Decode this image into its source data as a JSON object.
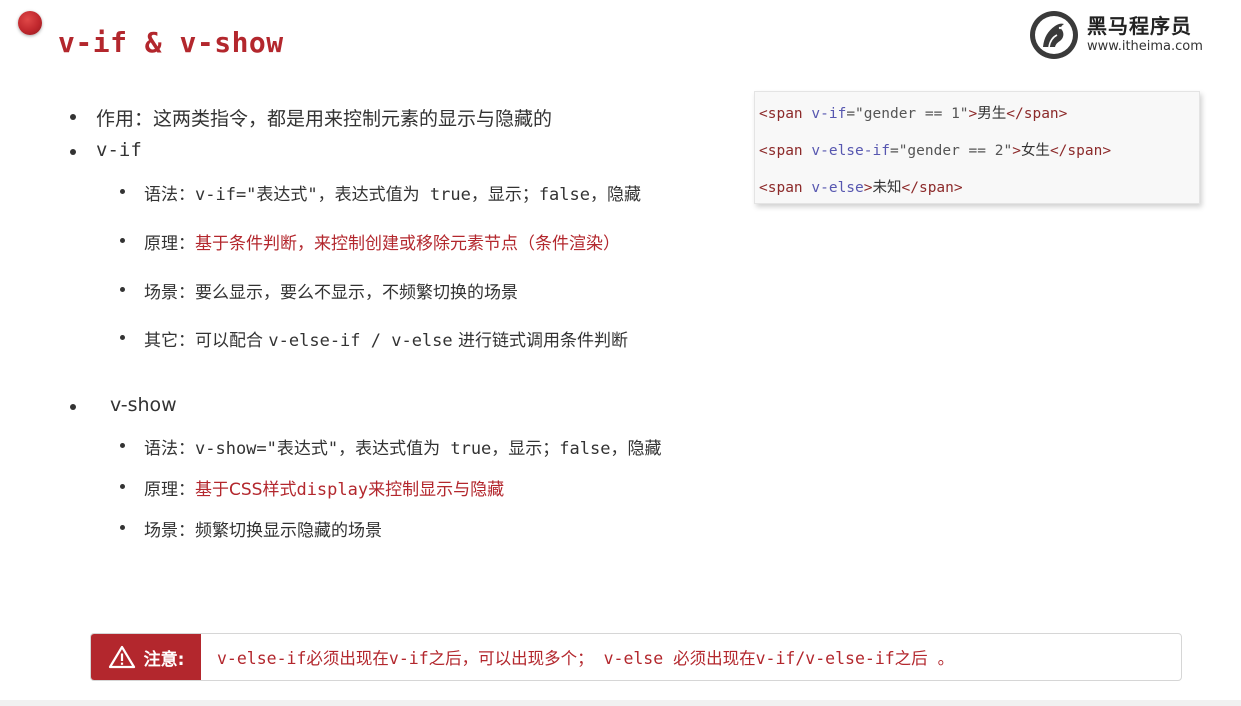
{
  "slide": {
    "title": "v-if & v-show"
  },
  "logo": {
    "name_cn": "黑马程序员",
    "url": "www.itheima.com",
    "icon": "horse-logo-icon"
  },
  "content": {
    "purpose": "作用：这两类指令，都是用来控制元素的显示与隐藏的",
    "vif": {
      "heading": "v-if",
      "syntax_prefix": "语法：",
      "syntax_code": "v-if=\"表达式\"，表达式值为 true，显示；false，隐藏",
      "principle_prefix": "原理：",
      "principle_text": "基于条件判断，来控制创建或移除元素节点（条件渲染）",
      "scene": "场景：要么显示，要么不显示，不频繁切换的场景",
      "other_prefix": "其它：可以配合 ",
      "other_code": "v-else-if / v-else",
      "other_suffix": " 进行链式调用条件判断"
    },
    "vshow": {
      "heading": "v-show",
      "syntax_prefix": "语法：",
      "syntax_code": "v-show=\"表达式\"，表达式值为 true，显示；false，隐藏",
      "principle_prefix": "原理：",
      "principle_a": "基于CSS样式",
      "principle_code": "display",
      "principle_b": "来控制显示与隐藏",
      "scene": "场景：频繁切换显示隐藏的场景"
    }
  },
  "code": {
    "lines": [
      {
        "open": "<span ",
        "attr": "v-if",
        "eq": "=",
        "value": "\"gender == 1\"",
        "close": ">",
        "text": "男生",
        "end": "</span>"
      },
      {
        "open": "<span ",
        "attr": "v-else-if",
        "eq": "=",
        "value": "\"gender == 2\"",
        "close": ">",
        "text": "女生",
        "end": "</span>"
      },
      {
        "open": "<span ",
        "attr": "v-else",
        "eq": "",
        "value": "",
        "close": ">",
        "text": "未知",
        "end": "</span>"
      }
    ]
  },
  "note": {
    "label": "注意:",
    "icon": "warning-icon",
    "text": "v-else-if必须出现在v-if之后，可以出现多个；  v-else 必须出现在v-if/v-else-if之后 。"
  },
  "colors": {
    "accent": "#b3272d",
    "text": "#333333",
    "code_tag": "#8c2a2a",
    "code_attr": "#5757b0"
  }
}
